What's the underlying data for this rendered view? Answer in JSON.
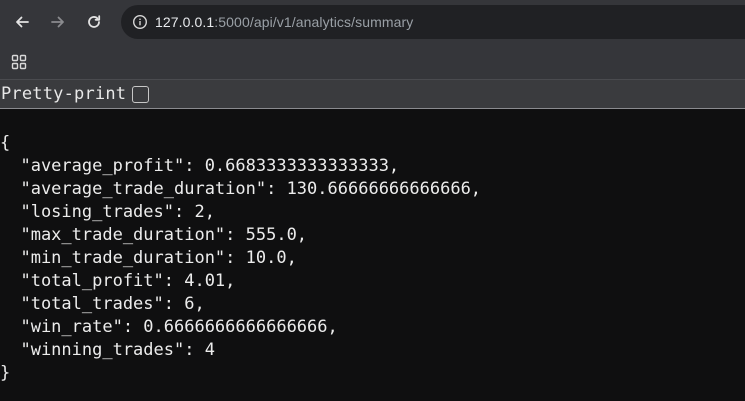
{
  "browser": {
    "back_icon": "arrow-left-icon",
    "forward_icon": "arrow-right-icon",
    "reload_icon": "reload-icon",
    "site_info_icon": "site-info-icon",
    "url_host": "127.0.0.1",
    "url_path": ":5000/api/v1/analytics/summary",
    "apps_icon": "apps-grid-icon",
    "colors": {
      "toolbar": "#35363a",
      "omnibox": "#202124",
      "page": "#0f0f10"
    }
  },
  "pretty_print": {
    "label": "Pretty-print",
    "checked": false
  },
  "json_text": "{\n  \"average_profit\": 0.6683333333333333,\n  \"average_trade_duration\": 130.66666666666666,\n  \"losing_trades\": 2,\n  \"max_trade_duration\": 555.0,\n  \"min_trade_duration\": 10.0,\n  \"total_profit\": 4.01,\n  \"total_trades\": 6,\n  \"win_rate\": 0.6666666666666666,\n  \"winning_trades\": 4\n}"
}
